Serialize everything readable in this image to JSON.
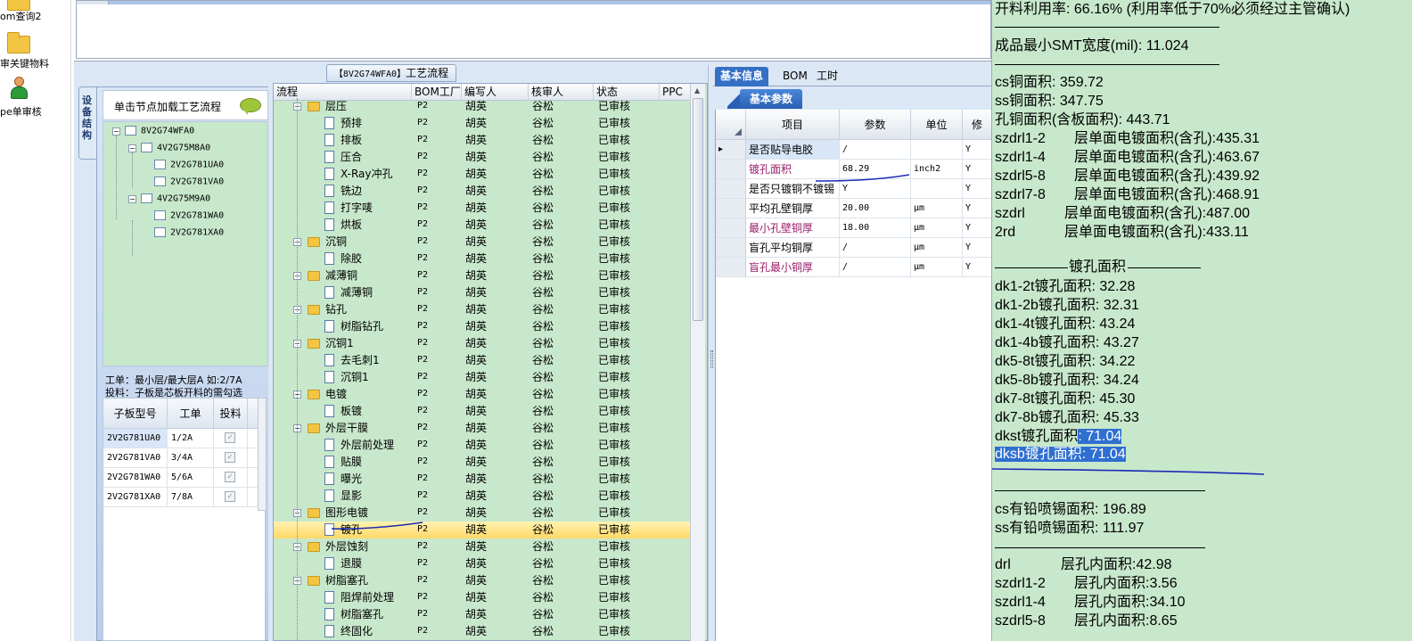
{
  "launcher": {
    "items": [
      {
        "label": "om查询2",
        "icon": "folder-icon"
      },
      {
        "label": "审关键物料",
        "icon": "folder-open-icon"
      },
      {
        "label": "pe单审核",
        "icon": "user-icon"
      }
    ]
  },
  "left_panel": {
    "vertical_tab": "设备结构",
    "tree_header": "单击节点加载工艺流程",
    "tree": [
      {
        "label": "8V2G74WFA0",
        "level": 0
      },
      {
        "label": "4V2G75M8A0",
        "level": 1
      },
      {
        "label": "2V2G781UA0",
        "level": 2
      },
      {
        "label": "2V2G781VA0",
        "level": 2
      },
      {
        "label": "4V2G75M9A0",
        "level": 1
      },
      {
        "label": "2V2G781WA0",
        "level": 2
      },
      {
        "label": "2V2G781XA0",
        "level": 2
      }
    ],
    "note_line1": "工单：最小层/最大层A 如:2/7A",
    "note_line2": "投料：子板是芯板开料的需勾选",
    "grid_headers": [
      "子板型号",
      "工单",
      "投料"
    ],
    "grid_rows": [
      {
        "model": "2V2G781UA0",
        "order": "1/2A",
        "feed": true
      },
      {
        "model": "2V2G781VA0",
        "order": "3/4A",
        "feed": true
      },
      {
        "model": "2V2G781WA0",
        "order": "5/6A",
        "feed": true
      },
      {
        "model": "2V2G781XA0",
        "order": "7/8A",
        "feed": true
      }
    ]
  },
  "flow": {
    "title_code": "【8V2G74WFA0】",
    "title_text": "工艺流程",
    "headers": [
      "流程",
      "BOM工厂",
      "编写人",
      "核审人",
      "状态",
      "PPC"
    ],
    "rows": [
      {
        "type": "group",
        "name": "层压",
        "bom": "P2",
        "writer": "胡英",
        "reviewer": "谷松",
        "status": "已审核"
      },
      {
        "type": "item",
        "name": "预排",
        "bom": "P2",
        "writer": "胡英",
        "reviewer": "谷松",
        "status": "已审核"
      },
      {
        "type": "item",
        "name": "排板",
        "bom": "P2",
        "writer": "胡英",
        "reviewer": "谷松",
        "status": "已审核"
      },
      {
        "type": "item",
        "name": "压合",
        "bom": "P2",
        "writer": "胡英",
        "reviewer": "谷松",
        "status": "已审核"
      },
      {
        "type": "item",
        "name": "X-Ray冲孔",
        "bom": "P2",
        "writer": "胡英",
        "reviewer": "谷松",
        "status": "已审核"
      },
      {
        "type": "item",
        "name": "铣边",
        "bom": "P2",
        "writer": "胡英",
        "reviewer": "谷松",
        "status": "已审核"
      },
      {
        "type": "item",
        "name": "打字唛",
        "bom": "P2",
        "writer": "胡英",
        "reviewer": "谷松",
        "status": "已审核"
      },
      {
        "type": "item",
        "name": "烘板",
        "bom": "P2",
        "writer": "胡英",
        "reviewer": "谷松",
        "status": "已审核"
      },
      {
        "type": "group",
        "name": "沉铜",
        "bom": "P2",
        "writer": "胡英",
        "reviewer": "谷松",
        "status": "已审核"
      },
      {
        "type": "item",
        "name": "除胶",
        "bom": "P2",
        "writer": "胡英",
        "reviewer": "谷松",
        "status": "已审核"
      },
      {
        "type": "group",
        "name": "减薄铜",
        "bom": "P2",
        "writer": "胡英",
        "reviewer": "谷松",
        "status": "已审核"
      },
      {
        "type": "item",
        "name": "减薄铜",
        "bom": "P2",
        "writer": "胡英",
        "reviewer": "谷松",
        "status": "已审核"
      },
      {
        "type": "group",
        "name": "钻孔",
        "bom": "P2",
        "writer": "胡英",
        "reviewer": "谷松",
        "status": "已审核"
      },
      {
        "type": "item",
        "name": "树脂钻孔",
        "bom": "P2",
        "writer": "胡英",
        "reviewer": "谷松",
        "status": "已审核"
      },
      {
        "type": "group",
        "name": "沉铜1",
        "bom": "P2",
        "writer": "胡英",
        "reviewer": "谷松",
        "status": "已审核"
      },
      {
        "type": "item",
        "name": "去毛刺1",
        "bom": "P2",
        "writer": "胡英",
        "reviewer": "谷松",
        "status": "已审核"
      },
      {
        "type": "item",
        "name": "沉铜1",
        "bom": "P2",
        "writer": "胡英",
        "reviewer": "谷松",
        "status": "已审核"
      },
      {
        "type": "group",
        "name": "电镀",
        "bom": "P2",
        "writer": "胡英",
        "reviewer": "谷松",
        "status": "已审核"
      },
      {
        "type": "item",
        "name": "板镀",
        "bom": "P2",
        "writer": "胡英",
        "reviewer": "谷松",
        "status": "已审核"
      },
      {
        "type": "group",
        "name": "外层干膜",
        "bom": "P2",
        "writer": "胡英",
        "reviewer": "谷松",
        "status": "已审核"
      },
      {
        "type": "item",
        "name": "外层前处理",
        "bom": "P2",
        "writer": "胡英",
        "reviewer": "谷松",
        "status": "已审核"
      },
      {
        "type": "item",
        "name": "贴膜",
        "bom": "P2",
        "writer": "胡英",
        "reviewer": "谷松",
        "status": "已审核"
      },
      {
        "type": "item",
        "name": "曝光",
        "bom": "P2",
        "writer": "胡英",
        "reviewer": "谷松",
        "status": "已审核"
      },
      {
        "type": "item",
        "name": "显影",
        "bom": "P2",
        "writer": "胡英",
        "reviewer": "谷松",
        "status": "已审核"
      },
      {
        "type": "group",
        "name": "图形电镀",
        "bom": "P2",
        "writer": "胡英",
        "reviewer": "谷松",
        "status": "已审核"
      },
      {
        "type": "item",
        "name": "镀孔",
        "bom": "P2",
        "writer": "胡英",
        "reviewer": "谷松",
        "status": "已审核",
        "selected": true
      },
      {
        "type": "group",
        "name": "外层蚀刻",
        "bom": "P2",
        "writer": "胡英",
        "reviewer": "谷松",
        "status": "已审核"
      },
      {
        "type": "item",
        "name": "退膜",
        "bom": "P2",
        "writer": "胡英",
        "reviewer": "谷松",
        "status": "已审核"
      },
      {
        "type": "group",
        "name": "树脂塞孔",
        "bom": "P2",
        "writer": "胡英",
        "reviewer": "谷松",
        "status": "已审核"
      },
      {
        "type": "item",
        "name": "阻焊前处理",
        "bom": "P2",
        "writer": "胡英",
        "reviewer": "谷松",
        "status": "已审核"
      },
      {
        "type": "item",
        "name": "树脂塞孔",
        "bom": "P2",
        "writer": "胡英",
        "reviewer": "谷松",
        "status": "已审核"
      },
      {
        "type": "item",
        "name": "终固化",
        "bom": "P2",
        "writer": "胡英",
        "reviewer": "谷松",
        "status": "已审核"
      }
    ]
  },
  "params": {
    "tabs": [
      "基本信息",
      "BOM",
      "工时"
    ],
    "subtab": "基本参数",
    "headers": [
      "项目",
      "参数",
      "单位",
      "修"
    ],
    "rows": [
      {
        "item": "是否贴导电胶",
        "value": "/",
        "unit": "",
        "flag": "Y",
        "color": "#000000"
      },
      {
        "item": "镀孔面积",
        "value": "68.29",
        "unit": "inch2",
        "flag": "Y",
        "color": "#9b1c6a"
      },
      {
        "item": "是否只镀铜不镀锡",
        "value": "Y",
        "unit": "",
        "flag": "Y",
        "color": "#000000"
      },
      {
        "item": "平均孔壁铜厚",
        "value": "20.00",
        "unit": "μm",
        "flag": "Y",
        "color": "#000000"
      },
      {
        "item": "最小孔壁铜厚",
        "value": "18.00",
        "unit": "μm",
        "flag": "Y",
        "color": "#9b1c6a"
      },
      {
        "item": "盲孔平均铜厚",
        "value": "/",
        "unit": "μm",
        "flag": "Y",
        "color": "#000000"
      },
      {
        "item": "盲孔最小铜厚",
        "value": "/",
        "unit": "μm",
        "flag": "Y",
        "color": "#9b1c6a"
      }
    ]
  },
  "summary": {
    "line_utilization": "开料利用率: 66.16% (利用率低于70%必须经过主管确认)",
    "line_smt": "成品最小SMT宽度(mil): 11.024",
    "copper": [
      "cs铜面积: 359.72",
      "ss铜面积: 347.75",
      "孔铜面积(含板面积): 443.71"
    ],
    "layer_plating": [
      {
        "a": "szdrl1-2",
        "b": "层单面电镀面积(含孔):435.31"
      },
      {
        "a": "szdrl1-4",
        "b": "层单面电镀面积(含孔):463.67"
      },
      {
        "a": "szdrl5-8",
        "b": "层单面电镀面积(含孔):439.92"
      },
      {
        "a": "szdrl7-8",
        "b": "层单面电镀面积(含孔):468.91"
      },
      {
        "a": "szdrl",
        "b": "层单面电镀面积(含孔):487.00"
      },
      {
        "a": "2rd",
        "b": "层单面电镀面积(含孔):433.11"
      }
    ],
    "section_title": "镀孔面积",
    "hole_plating": [
      "dk1-2t镀孔面积: 32.28",
      "dk1-2b镀孔面积: 32.31",
      "dk1-4t镀孔面积: 43.24",
      "dk1-4b镀孔面积: 43.27",
      "dk5-8t镀孔面积: 34.22",
      "dk5-8b镀孔面积: 34.24",
      "dk7-8t镀孔面积: 45.30",
      "dk7-8b镀孔面积: 45.33"
    ],
    "dkst_label": "dkst镀孔面积",
    "dkst_value": ": 71.04",
    "dksb_text": "dksb镀孔面积: 71.04",
    "lead_tin": [
      "cs有铅喷锡面积: 196.89",
      "ss有铅喷锡面积: 111.97"
    ],
    "inner_hole": [
      {
        "a": "drl",
        "b": "层孔内面积:42.98"
      },
      {
        "a": "szdrl1-2",
        "b": "层孔内面积:3.56"
      },
      {
        "a": "szdrl1-4",
        "b": "层孔内面积:34.10"
      },
      {
        "a": "szdrl5-8",
        "b": "层孔内面积:8.65"
      }
    ]
  }
}
